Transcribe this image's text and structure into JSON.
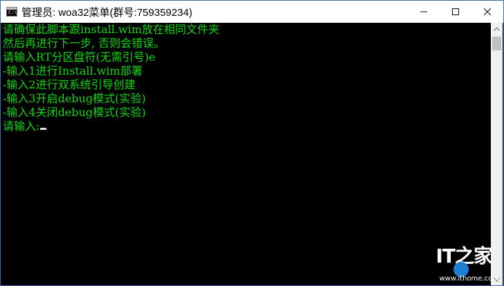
{
  "window": {
    "title": "管理员:  woa32菜单(群号:759359234)",
    "icon": "console-icon",
    "controls": [
      "minimize-icon",
      "maximize-icon",
      "close-icon"
    ]
  },
  "console": {
    "text_color": "#13d613",
    "lines": [
      "请确保此脚本跟install.wim放在相同文件夹",
      "然后再进行下一步, 否则会错误。",
      "请输入RT分区盘符(无需引号)e",
      "-输入1进行Install.wim部署",
      "-输入2进行双系统引导创建",
      "-输入3开启debug模式(实验)",
      "-输入4关闭debug模式(实验)"
    ],
    "prompt": "请输入:"
  },
  "watermark": {
    "logo": "IT之家",
    "url": "www.ithome.com"
  }
}
